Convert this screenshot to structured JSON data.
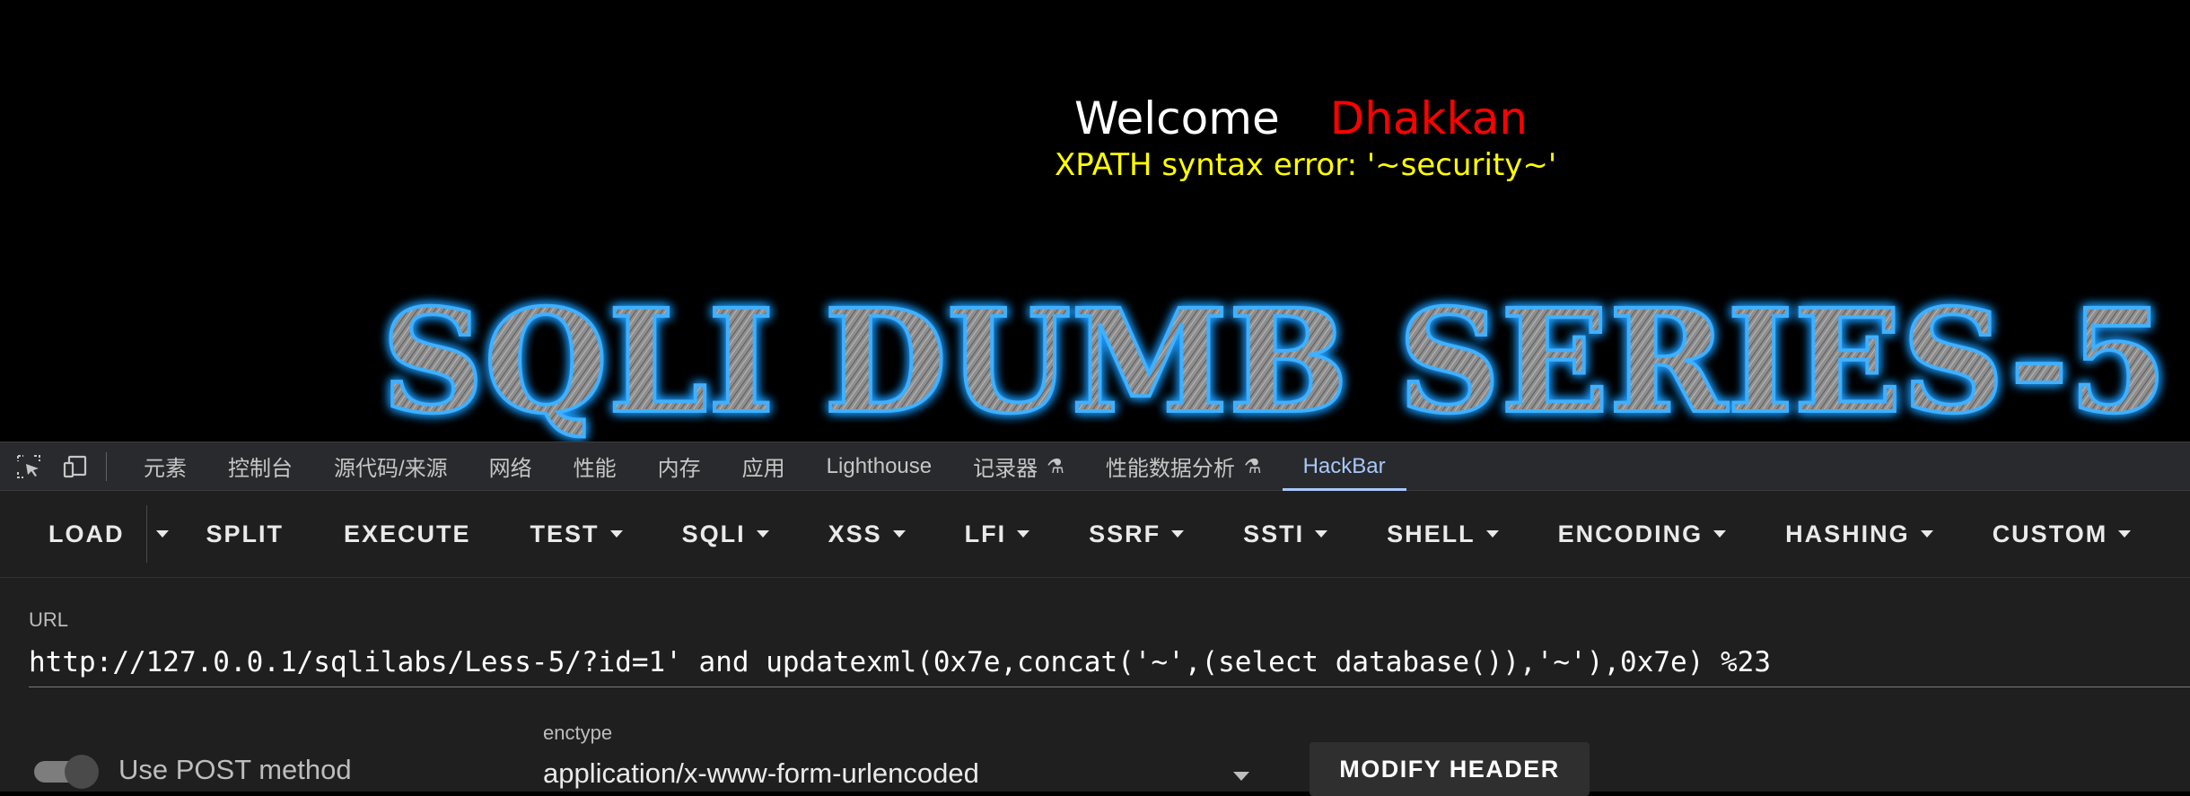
{
  "page": {
    "welcome_text": "Welcome",
    "welcome_name": "Dhakkan",
    "error_message": "XPATH syntax error: '~security~'",
    "banner_text": "SQLI DUMB SERIES-5"
  },
  "devtools": {
    "tabs": [
      {
        "label": "元素"
      },
      {
        "label": "控制台"
      },
      {
        "label": "源代码/来源"
      },
      {
        "label": "网络"
      },
      {
        "label": "性能"
      },
      {
        "label": "内存"
      },
      {
        "label": "应用"
      },
      {
        "label": "Lighthouse"
      },
      {
        "label": "记录器"
      },
      {
        "label": "性能数据分析"
      },
      {
        "label": "HackBar"
      }
    ],
    "active_tab": "HackBar",
    "flask_icon": "⚗"
  },
  "hackbar": {
    "toolbar": {
      "load": "LOAD",
      "split": "SPLIT",
      "execute": "EXECUTE",
      "test": "TEST",
      "sqli": "SQLI",
      "xss": "XSS",
      "lfi": "LFI",
      "ssrf": "SSRF",
      "ssti": "SSTI",
      "shell": "SHELL",
      "encoding": "ENCODING",
      "hashing": "HASHING",
      "custom": "CUSTOM"
    },
    "url_label": "URL",
    "url_value": "http://127.0.0.1/sqlilabs/Less-5/?id=1' and updatexml(0x7e,concat('~',(select database()),'~'),0x7e) %23",
    "post_method_label": "Use POST method",
    "post_method_enabled": false,
    "enctype_label": "enctype",
    "enctype_value": "application/x-www-form-urlencoded",
    "modify_header": "MODIFY HEADER"
  },
  "colors": {
    "page_bg": "#000000",
    "welcome": "#ffffff",
    "name": "#ff0000",
    "error": "#ffff00",
    "banner_glow": "#1e9bff",
    "devtools_bg": "#292a2d",
    "active_tab": "#a8c7fa",
    "hackbar_bg": "#1f1f1f"
  }
}
